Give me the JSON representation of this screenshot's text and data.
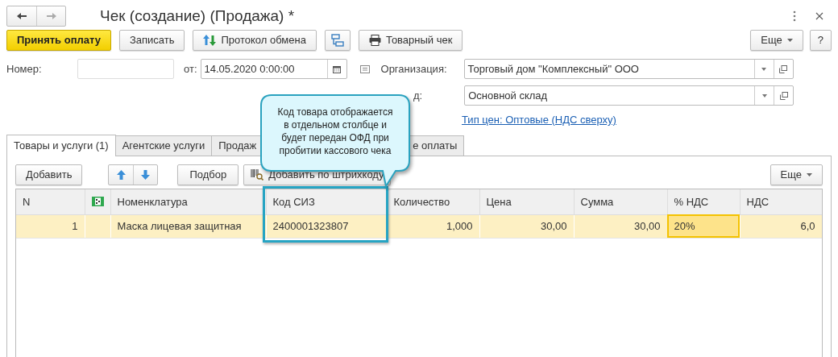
{
  "window": {
    "title": "Чек (создание) (Продажа) *"
  },
  "toolbar": {
    "buttons": [
      {
        "kind": "primary",
        "label": "Принять оплату"
      },
      {
        "kind": "plain",
        "label": "Записать"
      },
      {
        "kind": "exchange",
        "label": "Протокол обмена"
      },
      {
        "kind": "structure"
      },
      {
        "kind": "print",
        "label": "Товарный чек"
      }
    ],
    "more": "Еще",
    "help": "?"
  },
  "header": {
    "number_label": "Номер:",
    "date_label": "от:",
    "date_value": "14.05.2020  0:00:00",
    "org_label": "Организация:",
    "org_value": "Торговый дом \"Комплексный\" ООО",
    "warehouse_label": "д:",
    "warehouse_value": "Основной склад",
    "price_link": "Тип цен: Оптовые (НДС сверху)"
  },
  "tabs": [
    {
      "label": "Товары и услуги (1)",
      "selected": true
    },
    {
      "label": "Агентские услуги",
      "selected": false
    },
    {
      "label": "Продаж",
      "selected": false
    },
    {
      "label": "е оплаты",
      "selected": false
    }
  ],
  "table_toolbar": {
    "add": "Добавить",
    "pick": "Подбор",
    "barcode": "Добавить по штрихкоду",
    "more": "Еще"
  },
  "table": {
    "columns": [
      {
        "kind": "number",
        "label": "N",
        "highlighted": false
      },
      {
        "kind": "icon",
        "highlighted": false
      },
      {
        "kind": "text",
        "label": "Номенклатура",
        "highlighted": false
      },
      {
        "kind": "text",
        "label": "Код СИЗ",
        "highlighted": true
      },
      {
        "kind": "number",
        "label": "Количество",
        "highlighted": false
      },
      {
        "kind": "number",
        "label": "Цена",
        "highlighted": false
      },
      {
        "kind": "number",
        "label": "Сумма",
        "highlighted": false
      },
      {
        "kind": "text",
        "label": "% НДС",
        "highlighted": false
      },
      {
        "kind": "number",
        "label": "НДС",
        "highlighted": false
      }
    ],
    "rows": [
      {
        "selected": true,
        "cells": [
          {
            "text": "1",
            "active": false
          },
          {
            "active": false
          },
          {
            "text": "Маска лицевая защитная",
            "active": false
          },
          {
            "text": "2400001323807",
            "active": false
          },
          {
            "text": "1,000",
            "active": false
          },
          {
            "text": "30,00",
            "active": false
          },
          {
            "text": "30,00",
            "active": false
          },
          {
            "text": "20%",
            "active": true
          },
          {
            "text": "6,0",
            "active": false
          }
        ]
      }
    ]
  },
  "callout": {
    "text": "Код товара отображается в отдельном столбце и будет передан ОФД при пробитии кассового чека"
  }
}
